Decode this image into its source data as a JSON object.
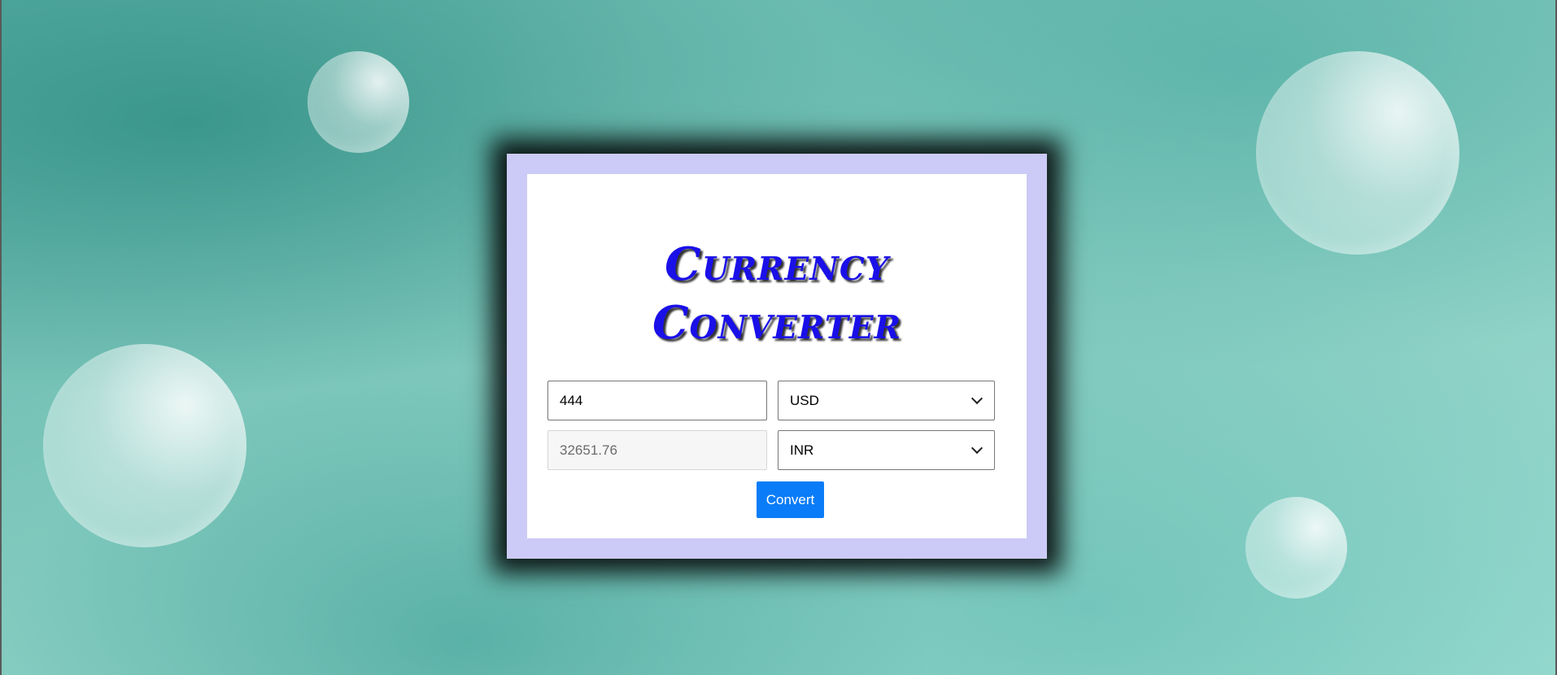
{
  "app": {
    "title_line1": "Currency",
    "title_line2": "Converter"
  },
  "converter": {
    "amount_value": "444",
    "from_currency": "USD",
    "converted_value": "32651.76",
    "to_currency": "INR",
    "convert_label": "Convert"
  },
  "colors": {
    "title": "#1a10e8",
    "button": "#0a7cf8",
    "card_border": "#cccaf6",
    "background": "#7cc6bb"
  },
  "icons": {
    "select_arrow": "chevron-down-icon"
  }
}
